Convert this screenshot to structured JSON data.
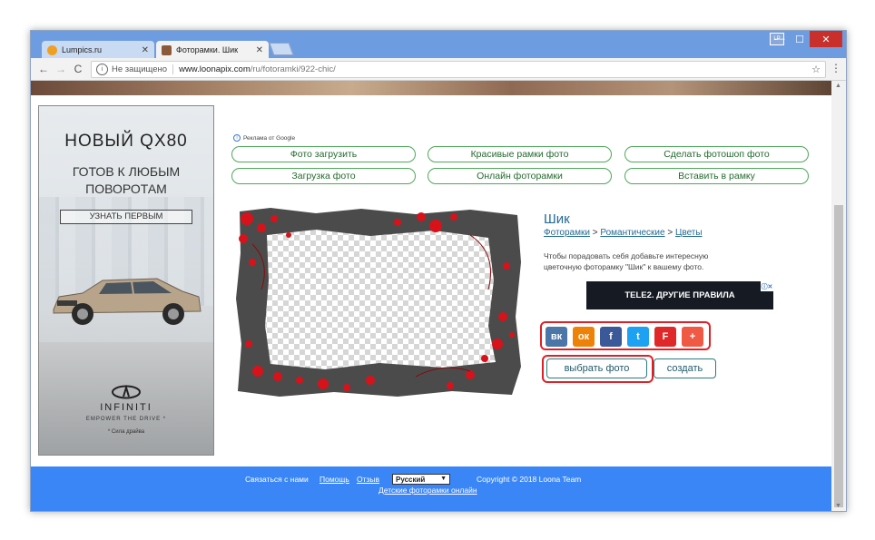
{
  "browser": {
    "tabs": [
      {
        "title": "Lumpics.ru",
        "active": false,
        "favicon_color": "#f0a020"
      },
      {
        "title": "Фоторамки. Шик",
        "active": true,
        "favicon_color": "#8a5a3a"
      }
    ],
    "profile_badge": "LP",
    "window_controls": {
      "minimize": "—",
      "maximize": "☐",
      "close": "✕"
    },
    "nav": {
      "back": "←",
      "forward": "→",
      "reload": "C"
    },
    "address": {
      "security_label": "Не защищено",
      "host": "www.loonapix.com",
      "path": "/ru/fotoramki/922-chic/"
    }
  },
  "ads": {
    "google_label": "Реклама от Google",
    "left_banner": {
      "headline": "НОВЫЙ QX80",
      "subheadline_1": "ГОТОВ К ЛЮБЫМ",
      "subheadline_2": "ПОВОРОТАМ",
      "cta": "УЗНАТЬ ПЕРВЫМ",
      "brand": "INFINITI",
      "slogan": "EMPOWER THE DRIVE *",
      "footnote": "* Сила драйва"
    },
    "tele2": {
      "text": "TELE2. ДРУГИЕ ПРАВИЛА"
    }
  },
  "link_buttons": [
    "Фото загрузить",
    "Красивые рамки фото",
    "Сделать фотошоп фото",
    "Загрузка фото",
    "Онлайн фоторамки",
    "Вставить в рамку"
  ],
  "frame": {
    "title": "Шик",
    "breadcrumb": [
      "Фоторамки",
      "Романтические",
      "Цветы"
    ],
    "breadcrumb_sep": ">",
    "description": "Чтобы порадовать себя добавьте интересную цветочную фоторамку \"Шик\" к вашему фото."
  },
  "share": [
    {
      "name": "vk",
      "label": "вк",
      "color": "#4a76a8"
    },
    {
      "name": "ok",
      "label": "ок",
      "color": "#ee8208"
    },
    {
      "name": "facebook",
      "label": "f",
      "color": "#3b5998"
    },
    {
      "name": "twitter",
      "label": "t",
      "color": "#1da1f2"
    },
    {
      "name": "flipboard",
      "label": "F",
      "color": "#e12828"
    },
    {
      "name": "more",
      "label": "+",
      "color": "#f05a45"
    }
  ],
  "actions": {
    "choose_photo": "выбрать фото",
    "create": "создать"
  },
  "footer": {
    "contact": "Связаться с нами",
    "help": "Помощь",
    "feedback": "Отзыв",
    "language": "Русский",
    "copyright": "Copyright © 2018 Loona Team",
    "kids_link": "Детские фоторамки онлайн"
  }
}
